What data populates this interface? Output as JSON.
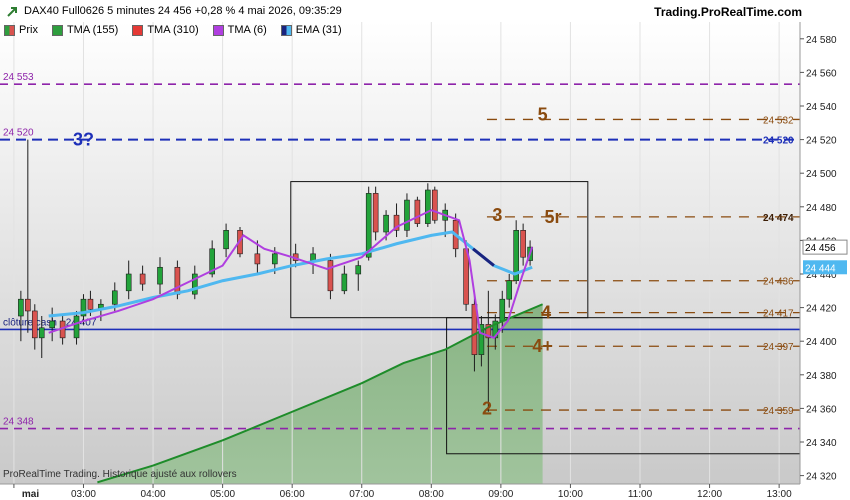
{
  "header": {
    "title": "DAX40 Full0626 5 minutes 24 456 +0,28 % 4 mai 2026, 09:35:29",
    "brand": "Trading.ProRealTime.com"
  },
  "legend": [
    {
      "label": "Prix"
    },
    {
      "label": "TMA (155)"
    },
    {
      "label": "TMA (310)"
    },
    {
      "label": "TMA (6)"
    },
    {
      "label": "EMA (31)"
    }
  ],
  "footer": {
    "text": "ProRealTime Trading. Historique ajusté aux rollovers"
  },
  "colors": {
    "up": "#22a33a",
    "down": "#d9534f",
    "tma155": "#1e8c2a",
    "tma6": "#b03fe0",
    "ema_light": "#4fb8f0",
    "ema_dark": "#1a237e",
    "purple_level": "#8e24aa",
    "blue_level": "#1a237e",
    "brown_level": "#8a4b0f"
  },
  "chart_data": {
    "type": "candlestick",
    "y_axis": {
      "ylim": [
        24315,
        24590
      ],
      "ticks": [
        24320,
        24340,
        24360,
        24380,
        24400,
        24420,
        24440,
        24460,
        24480,
        24500,
        24520,
        24540,
        24560,
        24580
      ],
      "tick_labels": [
        "24 320",
        "24 340",
        "24 360",
        "24 380",
        "24 400",
        "24 420",
        "24 440",
        "24 460",
        "24 480",
        "24 500",
        "24 520",
        "24 540",
        "24 560",
        "24 580"
      ]
    },
    "x_axis": {
      "ticks": [
        2,
        3,
        4,
        5,
        6,
        7,
        8,
        9,
        10,
        11,
        12,
        13
      ],
      "tick_labels": [
        "mai",
        "03:00",
        "04:00",
        "05:00",
        "06:00",
        "07:00",
        "08:00",
        "09:00",
        "10:00",
        "11:00",
        "12:00",
        "13:00"
      ]
    },
    "candles": [
      [
        2.1,
        24415,
        24430,
        24400,
        24425
      ],
      [
        2.2,
        24425,
        24520,
        24405,
        24418
      ],
      [
        2.3,
        24418,
        24422,
        24395,
        24402
      ],
      [
        2.4,
        24402,
        24415,
        24390,
        24408
      ],
      [
        2.55,
        24408,
        24420,
        24400,
        24412
      ],
      [
        2.7,
        24412,
        24416,
        24398,
        24402
      ],
      [
        2.9,
        24402,
        24418,
        24398,
        24415
      ],
      [
        3.0,
        24415,
        24428,
        24410,
        24425
      ],
      [
        3.1,
        24425,
        24430,
        24415,
        24419
      ],
      [
        3.25,
        24419,
        24425,
        24412,
        24422
      ],
      [
        3.45,
        24422,
        24435,
        24418,
        24430
      ],
      [
        3.65,
        24430,
        24448,
        24425,
        24440
      ],
      [
        3.85,
        24440,
        24445,
        24430,
        24434
      ],
      [
        4.1,
        24434,
        24450,
        24428,
        24444
      ],
      [
        4.35,
        24444,
        24448,
        24425,
        24428
      ],
      [
        4.6,
        24428,
        24445,
        24425,
        24440
      ],
      [
        4.85,
        24440,
        24460,
        24438,
        24455
      ],
      [
        5.05,
        24455,
        24470,
        24450,
        24466
      ],
      [
        5.25,
        24466,
        24468,
        24450,
        24452
      ],
      [
        5.5,
        24452,
        24460,
        24440,
        24446
      ],
      [
        5.75,
        24446,
        24456,
        24440,
        24452
      ],
      [
        6.05,
        24452,
        24458,
        24444,
        24448
      ],
      [
        6.3,
        24448,
        24456,
        24440,
        24452
      ],
      [
        6.55,
        24448,
        24452,
        24425,
        24430
      ],
      [
        6.75,
        24430,
        24445,
        24428,
        24440
      ],
      [
        6.95,
        24440,
        24448,
        24430,
        24445
      ],
      [
        7.1,
        24450,
        24492,
        24448,
        24488
      ],
      [
        7.2,
        24488,
        24492,
        24460,
        24465
      ],
      [
        7.35,
        24465,
        24478,
        24460,
        24475
      ],
      [
        7.5,
        24475,
        24482,
        24462,
        24466
      ],
      [
        7.65,
        24466,
        24488,
        24462,
        24484
      ],
      [
        7.8,
        24484,
        24486,
        24468,
        24470
      ],
      [
        7.95,
        24470,
        24494,
        24468,
        24490
      ],
      [
        8.05,
        24490,
        24492,
        24470,
        24472
      ],
      [
        8.2,
        24472,
        24482,
        24462,
        24478
      ],
      [
        8.35,
        24472,
        24476,
        24450,
        24455
      ],
      [
        8.5,
        24455,
        24460,
        24418,
        24422
      ],
      [
        8.62,
        24422,
        24430,
        24382,
        24392
      ],
      [
        8.72,
        24392,
        24415,
        24385,
        24410
      ],
      [
        8.82,
        24410,
        24430,
        24358,
        24402
      ],
      [
        8.92,
        24402,
        24416,
        24395,
        24412
      ],
      [
        9.02,
        24412,
        24430,
        24405,
        24425
      ],
      [
        9.12,
        24425,
        24440,
        24420,
        24436
      ],
      [
        9.22,
        24436,
        24472,
        24434,
        24466
      ],
      [
        9.32,
        24466,
        24470,
        24445,
        24450
      ],
      [
        9.42,
        24448,
        24460,
        24445,
        24456
      ]
    ],
    "levels": [
      {
        "value": 24553,
        "label": "24 553",
        "style": "purple-dash"
      },
      {
        "value": 24520,
        "label": "24 520",
        "style": "blue-dash"
      },
      {
        "value": 24532,
        "label": "24 532",
        "style": "brown-dash"
      },
      {
        "value": 24474,
        "label": "24 474",
        "style": "brown-dash"
      },
      {
        "value": 24436,
        "label": "24 436",
        "style": "brown-dash"
      },
      {
        "value": 24417,
        "label": "24 417",
        "style": "brown-dash"
      },
      {
        "value": 24397,
        "label": "24 397",
        "style": "brown-dash"
      },
      {
        "value": 24359,
        "label": "24 359",
        "style": "brown-dash"
      },
      {
        "value": 24348,
        "label": "24 348",
        "style": "purple-dash"
      },
      {
        "value": 24407,
        "label": "clôture cash -  24 407",
        "style": "blue-solid"
      }
    ],
    "right_badges": [
      {
        "value": 24532,
        "label": "24 532"
      },
      {
        "value": 24520,
        "label": "24 520"
      },
      {
        "value": 24474,
        "label": "24 474"
      },
      {
        "value": 24456,
        "label": "24 456"
      },
      {
        "value": 24444,
        "label": "24 444"
      },
      {
        "value": 24436,
        "label": "24 436"
      },
      {
        "value": 24417,
        "label": "24 417"
      },
      {
        "value": 24397,
        "label": "24 397"
      },
      {
        "value": 24359,
        "label": "24 359"
      }
    ],
    "annotations": [
      {
        "text": "3?",
        "x": 3.0,
        "y": 24520
      },
      {
        "text": "5",
        "x": 9.6,
        "y": 24535
      },
      {
        "text": "3",
        "x": 8.95,
        "y": 24475
      },
      {
        "text": "5r",
        "x": 9.75,
        "y": 24474
      },
      {
        "text": "4",
        "x": 9.65,
        "y": 24417
      },
      {
        "text": "4+",
        "x": 9.6,
        "y": 24397
      },
      {
        "text": "2",
        "x": 8.8,
        "y": 24360
      }
    ],
    "boxes": [
      {
        "x1": 5.98,
        "x2": 10.25,
        "y_top": 24495,
        "y_bottom": 24414
      },
      {
        "x1": 8.22,
        "x2": 13.4,
        "y_top": 24414,
        "y_bottom": 24333
      }
    ],
    "tma155": [
      [
        3.2,
        24316
      ],
      [
        4,
        24326
      ],
      [
        5,
        24341
      ],
      [
        6,
        24358
      ],
      [
        7,
        24375
      ],
      [
        7.6,
        24387
      ],
      [
        8.2,
        24395
      ],
      [
        8.8,
        24408
      ],
      [
        9.6,
        24422
      ]
    ],
    "tma6": [
      [
        2.5,
        24405
      ],
      [
        3,
        24412
      ],
      [
        3.5,
        24418
      ],
      [
        4,
        24425
      ],
      [
        4.5,
        24435
      ],
      [
        5,
        24445
      ],
      [
        5.3,
        24463
      ],
      [
        5.6,
        24455
      ],
      [
        6,
        24450
      ],
      [
        6.5,
        24443
      ],
      [
        7,
        24450
      ],
      [
        7.5,
        24468
      ],
      [
        8,
        24478
      ],
      [
        8.4,
        24472
      ],
      [
        8.55,
        24448
      ],
      [
        8.7,
        24405
      ],
      [
        8.9,
        24402
      ],
      [
        9.1,
        24412
      ],
      [
        9.3,
        24438
      ],
      [
        9.45,
        24456
      ]
    ],
    "ema31": [
      [
        2.5,
        24415
      ],
      [
        3,
        24417
      ],
      [
        3.5,
        24421
      ],
      [
        4,
        24426
      ],
      [
        4.5,
        24430
      ],
      [
        5,
        24436
      ],
      [
        5.5,
        24440
      ],
      [
        6,
        24445
      ],
      [
        6.5,
        24449
      ],
      [
        7,
        24452
      ],
      [
        7.5,
        24458
      ],
      [
        8,
        24463
      ],
      [
        8.3,
        24465
      ],
      [
        8.6,
        24455
      ],
      [
        8.9,
        24445
      ],
      [
        9.2,
        24440
      ],
      [
        9.45,
        24444
      ]
    ],
    "ema31_dark_segments": [
      [
        6.4,
        6.95
      ],
      [
        8.55,
        9.1
      ]
    ],
    "green_fill_until_x": 9.6
  }
}
